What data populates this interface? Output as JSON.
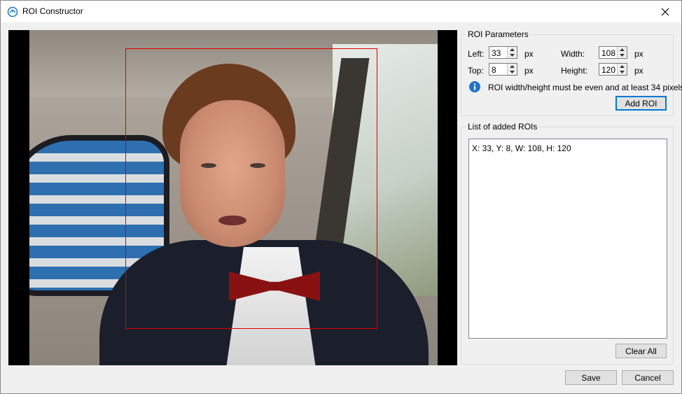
{
  "window": {
    "title": "ROI Constructor",
    "icon": "roi-constructor-app-icon",
    "close_icon": "close-icon"
  },
  "preview": {
    "roi_color": "#e00000"
  },
  "roi_parameters": {
    "group_title": "ROI Parameters",
    "left": {
      "label": "Left:",
      "value": "33",
      "unit": "px"
    },
    "top": {
      "label": "Top:",
      "value": "8",
      "unit": "px"
    },
    "width": {
      "label": "Width:",
      "value": "108",
      "unit": "px"
    },
    "height": {
      "label": "Height:",
      "value": "120",
      "unit": "px"
    },
    "info_icon": "info-icon",
    "info_text": "ROI width/height must be even and at least 34 pixels",
    "add_button": "Add ROI"
  },
  "roi_list": {
    "group_title": "List of added ROIs",
    "items": [
      "X: 33, Y: 8, W: 108, H: 120"
    ],
    "clear_button": "Clear All"
  },
  "footer": {
    "save_button": "Save",
    "cancel_button": "Cancel"
  },
  "colors": {
    "accent": "#0078d7",
    "info_blue": "#1e74c8"
  }
}
